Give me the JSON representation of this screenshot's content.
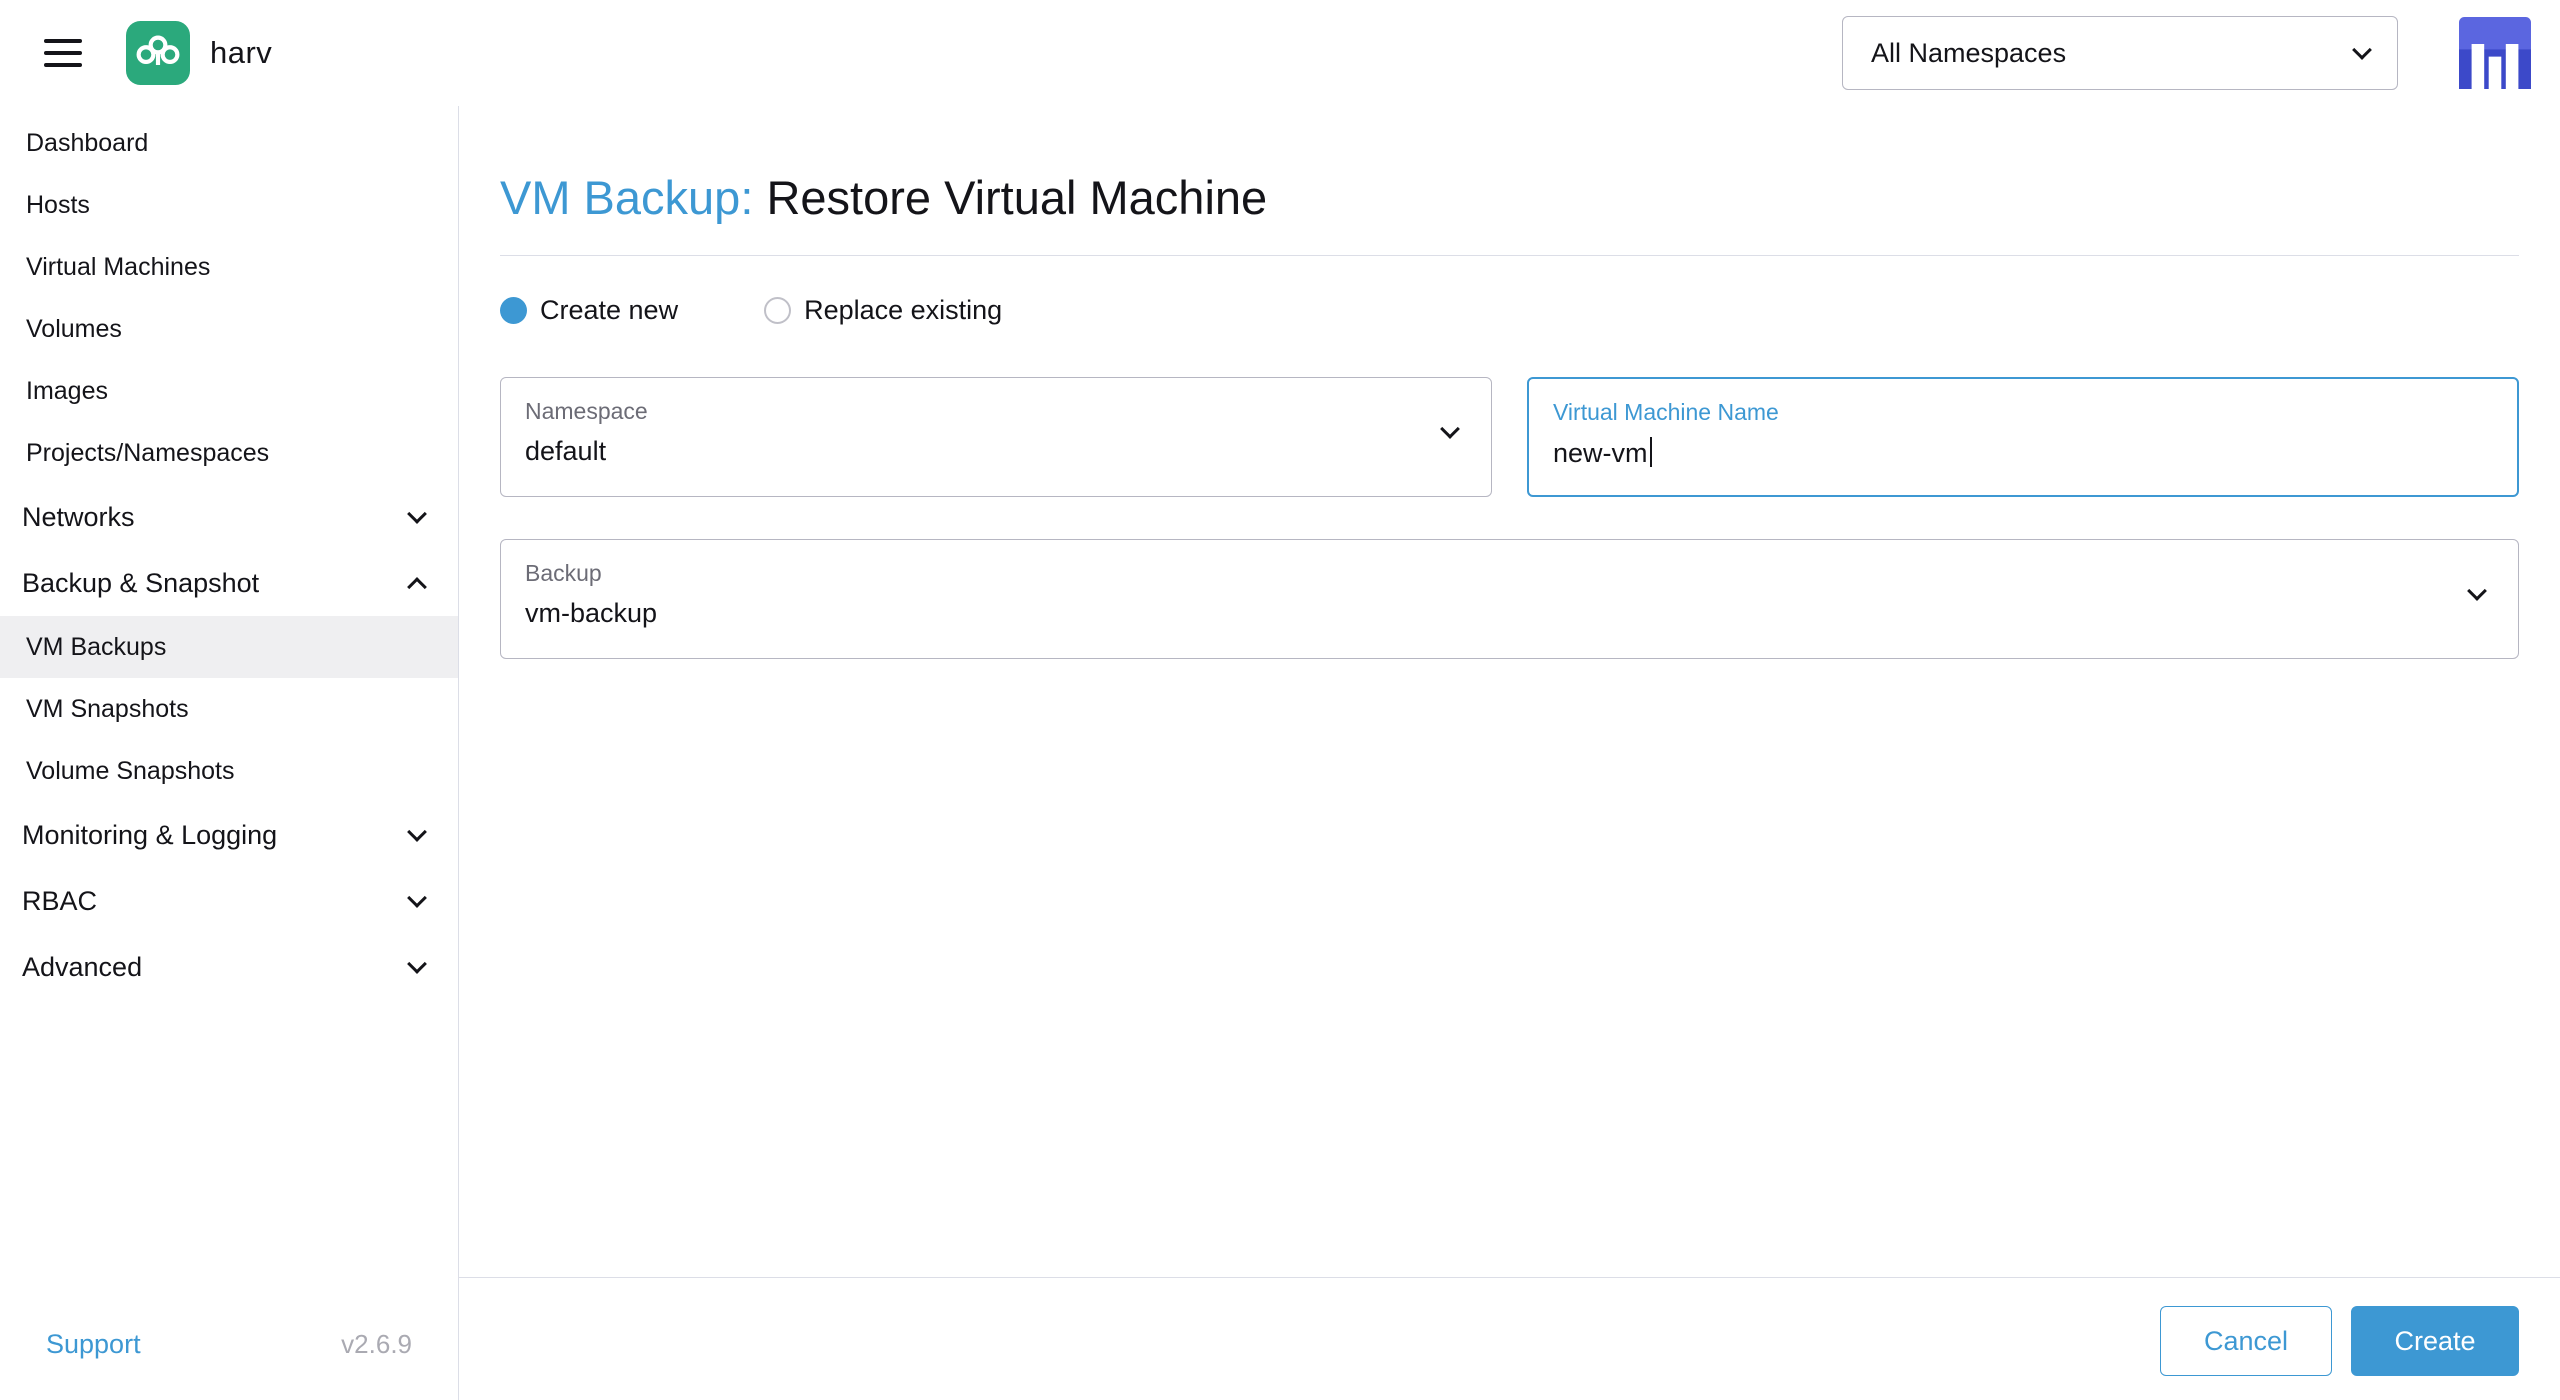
{
  "colors": {
    "primary": "#3d98d3",
    "text": "#141419",
    "muted_label": "#6c6c76",
    "input_border": "#b6b6c2",
    "divider": "#dcdee7",
    "selected_nav_bg": "#efeff1",
    "logo_green": "#2ba97c",
    "avatar_blue": "#4a5bd8"
  },
  "header": {
    "product": "harv",
    "namespace_filter": "All Namespaces"
  },
  "sidebar": {
    "items": [
      {
        "label": "Dashboard",
        "type": "item"
      },
      {
        "label": "Hosts",
        "type": "item"
      },
      {
        "label": "Virtual Machines",
        "type": "item"
      },
      {
        "label": "Volumes",
        "type": "item"
      },
      {
        "label": "Images",
        "type": "item"
      },
      {
        "label": "Projects/Namespaces",
        "type": "item"
      },
      {
        "label": "Networks",
        "type": "group",
        "expanded": false
      },
      {
        "label": "Backup & Snapshot",
        "type": "group",
        "expanded": true
      },
      {
        "label": "VM Backups",
        "type": "item",
        "selected": true
      },
      {
        "label": "VM Snapshots",
        "type": "item"
      },
      {
        "label": "Volume Snapshots",
        "type": "item"
      },
      {
        "label": "Monitoring & Logging",
        "type": "group",
        "expanded": false
      },
      {
        "label": "RBAC",
        "type": "group",
        "expanded": false
      },
      {
        "label": "Advanced",
        "type": "group",
        "expanded": false
      }
    ],
    "support_label": "Support",
    "version": "v2.6.9"
  },
  "main": {
    "title_prefix": "VM Backup:",
    "title": "Restore Virtual Machine",
    "radio_options": [
      {
        "label": "Create new",
        "selected": true
      },
      {
        "label": "Replace existing",
        "selected": false
      }
    ],
    "fields": {
      "namespace": {
        "label": "Namespace",
        "value": "default"
      },
      "vm_name": {
        "label": "Virtual Machine Name",
        "value": "new-vm",
        "focused": true
      },
      "backup": {
        "label": "Backup",
        "value": "vm-backup"
      }
    },
    "actions": {
      "cancel": "Cancel",
      "create": "Create"
    }
  },
  "icons": {
    "menu": "hamburger-icon",
    "logo": "harvester-logo",
    "namespace_chevron": "chevron-down-icon",
    "avatar": "user-avatar"
  }
}
